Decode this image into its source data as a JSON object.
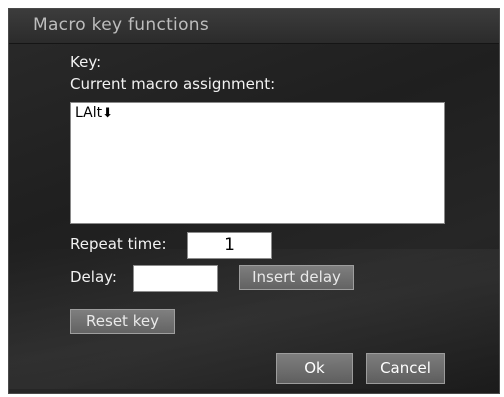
{
  "dialog": {
    "title": "Macro key functions",
    "key_label": "Key:",
    "current_assignment_label": "Current macro assignment:",
    "assignment_value": "LAlt",
    "assignment_arrow": "⬇",
    "repeat_label": "Repeat time:",
    "repeat_value": "1",
    "delay_label": "Delay:",
    "delay_value": "",
    "insert_delay_label": "Insert delay",
    "reset_key_label": "Reset key",
    "ok_label": "Ok",
    "cancel_label": "Cancel"
  }
}
